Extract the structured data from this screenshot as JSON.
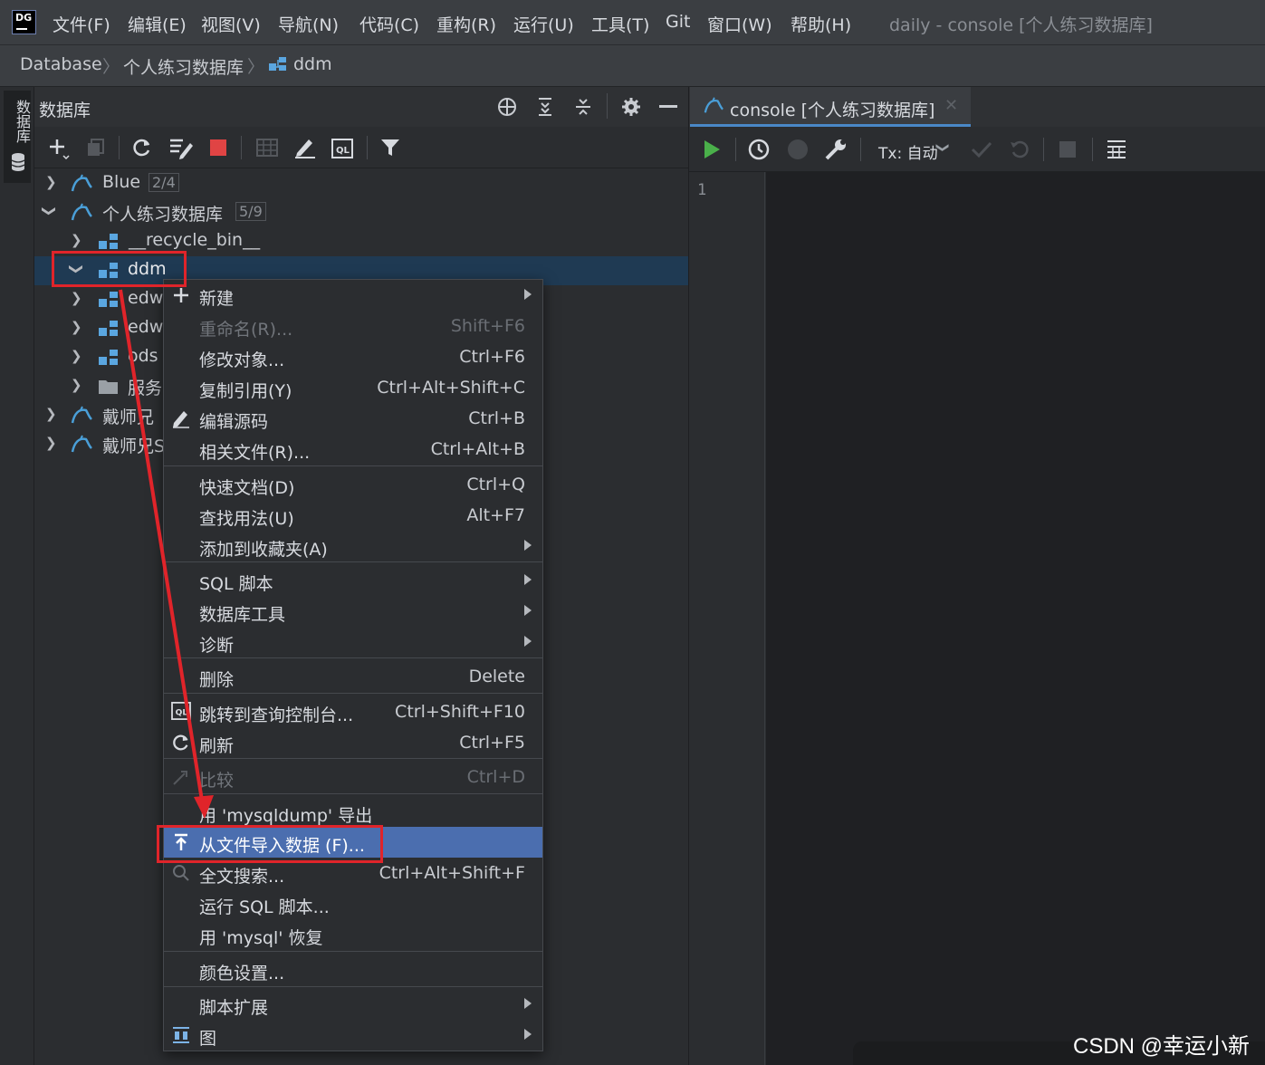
{
  "menubar": {
    "logo_text": "DG",
    "items": [
      "文件(F)",
      "编辑(E)",
      "视图(V)",
      "导航(N)",
      "代码(C)",
      "重构(R)",
      "运行(U)",
      "工具(T)",
      "Git",
      "窗口(W)",
      "帮助(H)"
    ],
    "window_title": "daily - console [个人练习数据库]"
  },
  "breadcrumb": {
    "items": [
      "Database",
      "个人练习数据库",
      "ddm"
    ],
    "separator": "〉"
  },
  "tool_stripe": {
    "label": "数据库"
  },
  "db_panel": {
    "title": "数据库",
    "header_icons": [
      "crosshair-icon",
      "expand-all-icon",
      "collapse-all-icon",
      "gear-icon",
      "minimize-icon"
    ],
    "toolbar_icons": [
      "add-icon",
      "duplicate-icon",
      "refresh-icon",
      "edit-schema-icon",
      "stop-icon",
      "table-icon",
      "edit-icon",
      "console-icon",
      "filter-icon"
    ],
    "tree": [
      {
        "label": "Blue",
        "badge": "2/4",
        "expanded": false,
        "level": 0,
        "icon": "mysql-icon"
      },
      {
        "label": "个人练习数据库",
        "badge": "5/9",
        "expanded": true,
        "level": 0,
        "icon": "mysql-icon"
      },
      {
        "label": "__recycle_bin__",
        "expanded": false,
        "level": 1,
        "icon": "schema-icon"
      },
      {
        "label": "ddm",
        "expanded": true,
        "level": 1,
        "icon": "schema-icon",
        "selected": true
      },
      {
        "label": "edw",
        "expanded": false,
        "level": 1,
        "icon": "schema-icon"
      },
      {
        "label": "edw",
        "expanded": false,
        "level": 1,
        "icon": "schema-icon"
      },
      {
        "label": "ods",
        "expanded": false,
        "level": 1,
        "icon": "schema-icon"
      },
      {
        "label": "服务",
        "expanded": false,
        "level": 1,
        "icon": "folder-icon"
      },
      {
        "label": "戴师兄",
        "expanded": false,
        "level": 0,
        "icon": "mysql-icon"
      },
      {
        "label": "戴师兄S",
        "expanded": false,
        "level": 0,
        "icon": "mysql-icon"
      }
    ]
  },
  "editor": {
    "tab_label": "console [个人练习数据库]",
    "tx_label": "Tx: 自动",
    "line_numbers": [
      "1"
    ]
  },
  "context_menu": {
    "items": [
      {
        "label": "新建",
        "shortcut": "",
        "submenu": true,
        "icon": "plus-icon"
      },
      {
        "label": "重命名(R)...",
        "shortcut": "Shift+F6",
        "disabled": true
      },
      {
        "label": "修改对象...",
        "shortcut": "Ctrl+F6"
      },
      {
        "label": "复制引用(Y)",
        "shortcut": "Ctrl+Alt+Shift+C"
      },
      {
        "label": "编辑源码",
        "shortcut": "Ctrl+B",
        "icon": "pencil-icon"
      },
      {
        "label": "相关文件(R)...",
        "shortcut": "Ctrl+Alt+B"
      },
      {
        "label": "快速文档(D)",
        "shortcut": "Ctrl+Q"
      },
      {
        "label": "查找用法(U)",
        "shortcut": "Alt+F7"
      },
      {
        "label": "添加到收藏夹(A)",
        "shortcut": "",
        "submenu": true
      },
      {
        "label": "SQL 脚本",
        "shortcut": "",
        "submenu": true
      },
      {
        "label": "数据库工具",
        "shortcut": "",
        "submenu": true
      },
      {
        "label": "诊断",
        "shortcut": "",
        "submenu": true
      },
      {
        "label": "删除",
        "shortcut": "Delete"
      },
      {
        "label": "跳转到查询控制台...",
        "shortcut": "Ctrl+Shift+F10",
        "icon": "console-icon"
      },
      {
        "label": "刷新",
        "shortcut": "Ctrl+F5",
        "icon": "refresh-icon"
      },
      {
        "label": "比较",
        "shortcut": "Ctrl+D",
        "disabled": true,
        "icon": "compare-icon"
      },
      {
        "label": "用 'mysqldump' 导出",
        "shortcut": ""
      },
      {
        "label": "从文件导入数据 (F)...",
        "shortcut": "",
        "highlighted": true,
        "icon": "import-icon"
      },
      {
        "label": "全文搜索...",
        "shortcut": "Ctrl+Alt+Shift+F",
        "icon": "search-icon"
      },
      {
        "label": "运行 SQL 脚本...",
        "shortcut": ""
      },
      {
        "label": "用 'mysql' 恢复",
        "shortcut": ""
      },
      {
        "label": "颜色设置...",
        "shortcut": ""
      },
      {
        "label": "脚本扩展",
        "shortcut": "",
        "submenu": true
      },
      {
        "label": "图",
        "shortcut": "",
        "submenu": true,
        "icon": "diagram-icon"
      }
    ]
  },
  "watermark": "CSDN @幸运小新",
  "colors": {
    "background": "#2b2d30",
    "selection": "#1f3a53",
    "menu_highlight": "#4b6eaf",
    "annotation_red": "#e0242a",
    "mysql_blue": "#4a9fd8",
    "schema_blue": "#5aa6e0",
    "run_green": "#4ab04a",
    "stop_red": "#e04444"
  }
}
